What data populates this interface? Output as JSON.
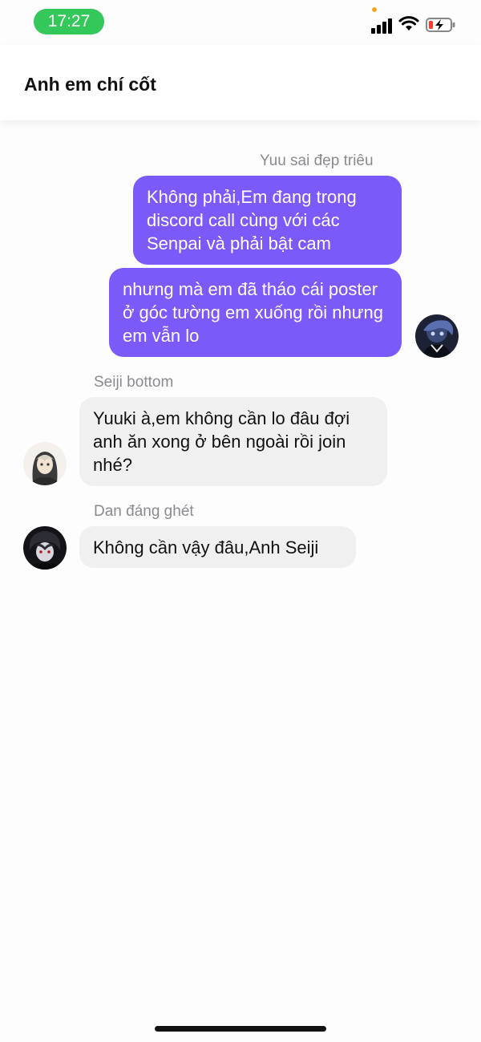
{
  "status_bar": {
    "time": "17:27",
    "icons": [
      "signal-icon",
      "wifi-icon",
      "battery-charging-icon"
    ]
  },
  "header": {
    "title": "Anh em chí cốt"
  },
  "messages": [
    {
      "sender": "Yuu sai đẹp triêu",
      "direction": "outgoing",
      "bubbles": [
        "Không phải,Em đang trong discord call cùng với các Senpai và phải bật cam",
        "nhưng mà em đã tháo cái poster ở góc tường em xuống rồi nhưng em vẫn lo"
      ]
    },
    {
      "sender": "Seiji bottom",
      "direction": "incoming",
      "bubbles": [
        "Yuuki à,em không cần lo đâu đợi anh ăn xong ở bên ngoài rồi join nhé?"
      ]
    },
    {
      "sender": "Dan đáng ghét",
      "direction": "incoming",
      "bubbles": [
        "Không cần vậy đâu,Anh Seiji"
      ]
    }
  ],
  "colors": {
    "outgoing_bubble": "#7a5af8",
    "incoming_bubble": "#f0f0f0",
    "time_pill": "#34c759"
  }
}
